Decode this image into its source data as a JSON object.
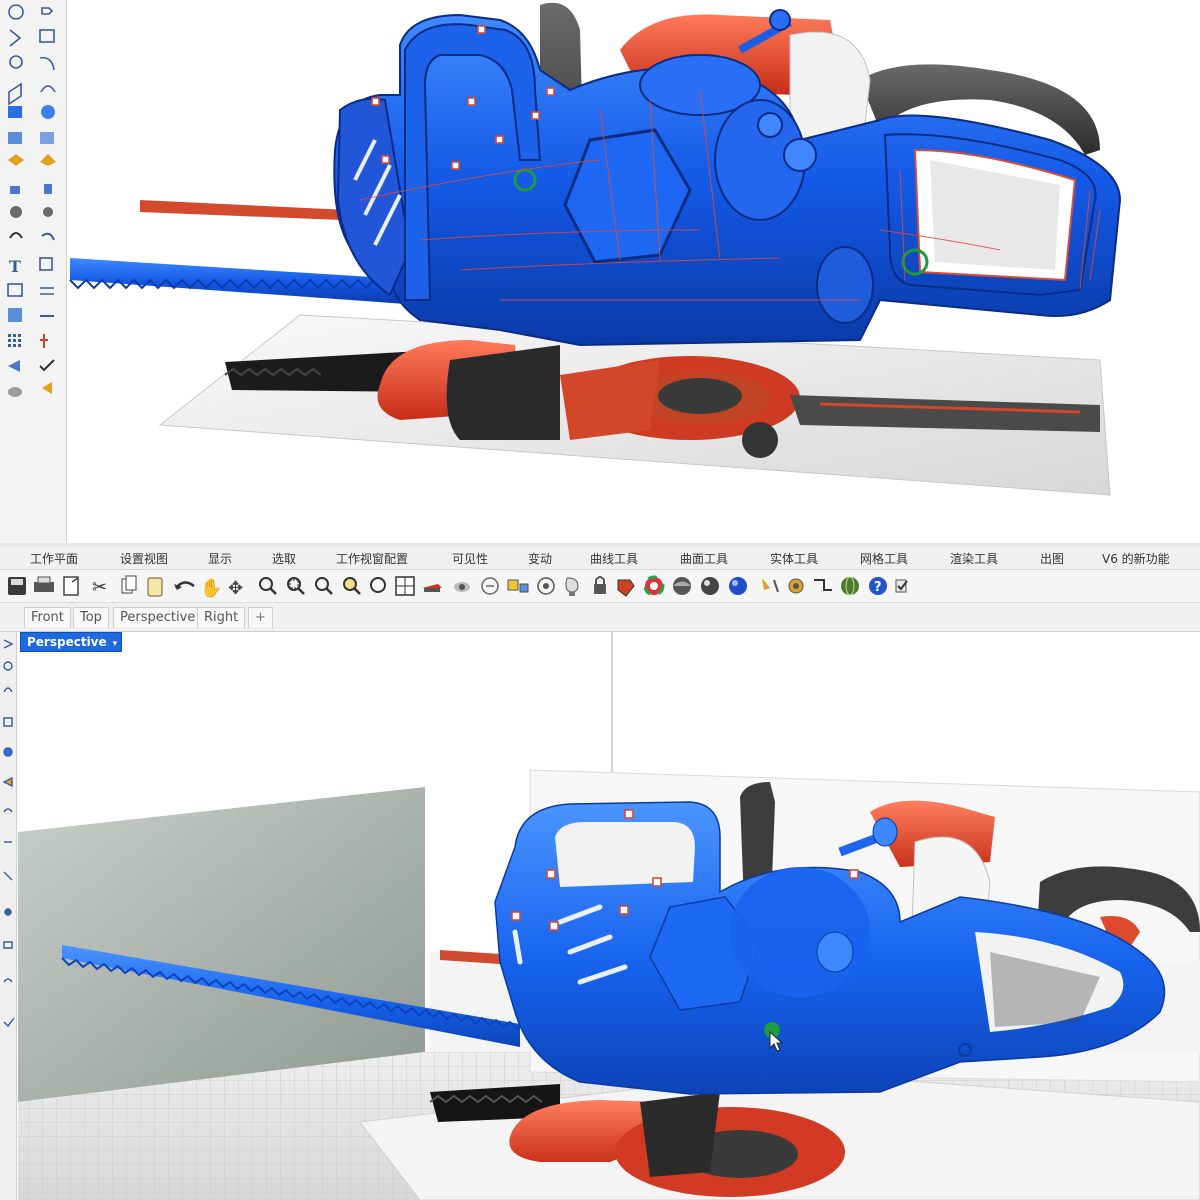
{
  "menu": {
    "tabs": [
      "工作平面",
      "设置视图",
      "显示",
      "选取",
      "工作视窗配置",
      "可见性",
      "变动",
      "曲线工具",
      "曲面工具",
      "实体工具",
      "网格工具",
      "渲染工具",
      "出图",
      "V6 的新功能"
    ]
  },
  "toolbar": {
    "icons": [
      "save-icon",
      "print-icon",
      "import-icon",
      "cut-icon",
      "copy-icon",
      "paste-icon",
      "undo-icon",
      "pan-hand-icon",
      "move-view-icon",
      "zoom-icon",
      "zoom-window-icon",
      "zoom-extents-icon",
      "zoom-selected-icon",
      "rotate-view-icon",
      "four-viewports-icon",
      "set-cplane-icon",
      "show-objects-icon",
      "hide-objects-icon",
      "lock-objects-icon",
      "layer-icon",
      "object-properties-icon",
      "lights-icon",
      "lock-icon",
      "material-icon",
      "color-wheel-icon",
      "shaded-sphere-icon",
      "rendered-sphere-icon",
      "render-sphere-icon",
      "dimension-icon",
      "options-gear-icon",
      "grasshopper-icon",
      "globe-icon",
      "help-icon",
      "check-icon"
    ]
  },
  "view_tabs": {
    "front": "Front",
    "top": "Top",
    "perspective": "Perspective",
    "right": "Right",
    "add": "+"
  },
  "viewport": {
    "active_label": "Perspective",
    "label_dropdown": "▾"
  },
  "colors": {
    "accent_blue": "#1f6ff0",
    "model_blue": "#1a66e8",
    "model_red": "#e2482f",
    "viewport_label": "#1e6ae0"
  },
  "palette": {
    "icons": [
      "circle-icon",
      "point-icon",
      "polyline-icon",
      "rectangle-icon",
      "circle-tool-icon",
      "curve-icon",
      "surface-icon",
      "extrude-icon",
      "box-icon",
      "sphere-icon",
      "cylinder-icon",
      "mesh-icon",
      "trim-icon",
      "split-icon",
      "boolean-icon",
      "fillet-icon",
      "text-icon",
      "array-icon",
      "explode-icon",
      "join-icon",
      "group-icon",
      "analyze-icon",
      "dimension-icon",
      "transform-icon",
      "grid-icon",
      "snap-icon",
      "render-icon",
      "check-icon",
      "layer-icon",
      "paint-icon"
    ]
  }
}
